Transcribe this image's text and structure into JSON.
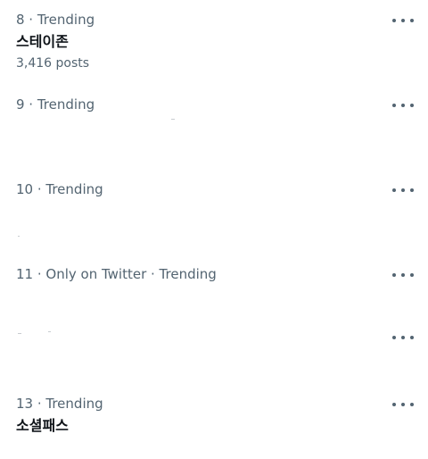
{
  "trends": [
    {
      "meta": "8 · Trending",
      "title": "스테이존",
      "count": "3,416 posts"
    },
    {
      "meta": "9 · Trending"
    },
    {
      "meta": "10 · Trending"
    },
    {
      "meta": "11 · Only on Twitter · Trending"
    },
    {
      "meta": "13 · Trending",
      "title": "소셜패스"
    }
  ],
  "icons": {
    "more": "more-horizontal-icon"
  },
  "colors": {
    "primary_text": "#0f1419",
    "secondary_text": "#536471",
    "background": "#ffffff"
  }
}
